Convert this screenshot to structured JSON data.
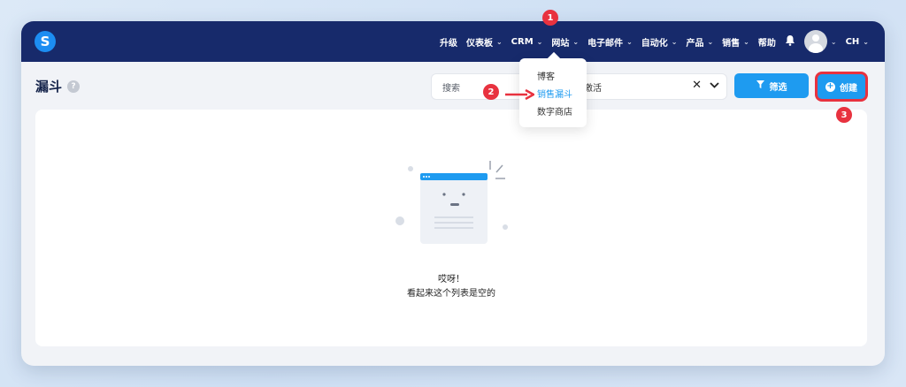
{
  "topbar": {
    "logo_letter": "S",
    "nav": [
      {
        "label": "升级",
        "has_chevron": false
      },
      {
        "label": "仪表板",
        "has_chevron": true
      },
      {
        "label": "CRM",
        "has_chevron": true
      },
      {
        "label": "网站",
        "has_chevron": true
      },
      {
        "label": "电子邮件",
        "has_chevron": true
      },
      {
        "label": "自动化",
        "has_chevron": true
      },
      {
        "label": "产品",
        "has_chevron": true
      },
      {
        "label": "销售",
        "has_chevron": true
      },
      {
        "label": "帮助",
        "has_chevron": false
      }
    ],
    "user_initials": "CH"
  },
  "page": {
    "title": "漏斗",
    "help_symbol": "?"
  },
  "search": {
    "placeholder": "搜索",
    "status_filter": "激活",
    "clear_symbol": "✕",
    "chevron": "⌄"
  },
  "buttons": {
    "filter_label": "筛选",
    "create_label": "创建"
  },
  "website_menu": {
    "items": [
      "博客",
      "销售漏斗",
      "数字商店"
    ],
    "active_index": 1
  },
  "empty_state": {
    "line1": "哎呀！",
    "line2": "看起来这个列表是空的"
  },
  "annotations": {
    "steps": [
      "1",
      "2",
      "3"
    ],
    "color": "#e8323f"
  },
  "colors": {
    "topbar": "#172a6b",
    "accent": "#1e9bf0",
    "background": "#f1f3f7"
  }
}
